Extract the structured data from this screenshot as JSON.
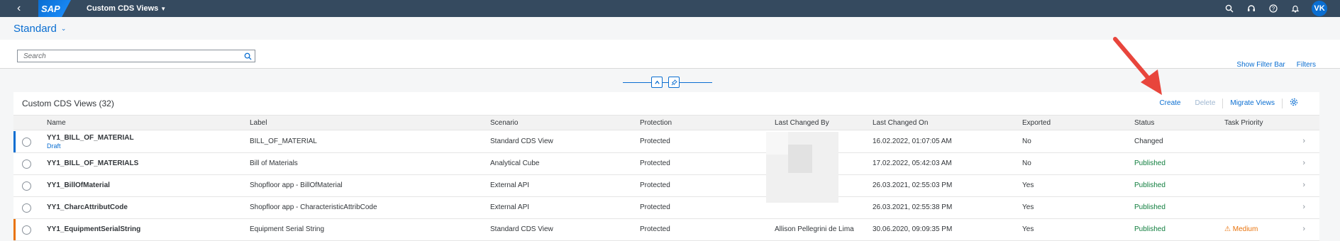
{
  "shell": {
    "logo": "SAP",
    "app_title": "Custom CDS Views",
    "avatar": "VK",
    "icons": [
      "chevron-left-icon",
      "search-icon",
      "headset-icon",
      "help-icon",
      "bell-icon"
    ]
  },
  "variant": {
    "title": "Standard"
  },
  "filter": {
    "search_placeholder": "Search",
    "show_filter_bar": "Show Filter Bar",
    "filters": "Filters"
  },
  "table": {
    "title": "Custom CDS Views (32)",
    "toolbar": {
      "create": "Create",
      "delete": "Delete",
      "migrate": "Migrate Views"
    },
    "columns": [
      "Name",
      "Label",
      "Scenario",
      "Protection",
      "Last Changed By",
      "Last Changed On",
      "Exported",
      "Status",
      "Task Priority"
    ],
    "rows": [
      {
        "name": "YY1_BILL_OF_MATERIAL",
        "draft": "Draft",
        "label": "BILL_OF_MATERIAL",
        "scenario": "Standard CDS View",
        "protection": "Protected",
        "changed_by": "",
        "changed_on": "16.02.2022, 01:07:05 AM",
        "exported": "No",
        "status": "Changed",
        "priority": "",
        "marker_color": "#0a6ed1"
      },
      {
        "name": "YY1_BILL_OF_MATERIALS",
        "draft": "",
        "label": "Bill of Materials",
        "scenario": "Analytical Cube",
        "protection": "Protected",
        "changed_by": "",
        "changed_on": "17.02.2022, 05:42:03 AM",
        "exported": "No",
        "status": "Published",
        "priority": "",
        "marker_color": ""
      },
      {
        "name": "YY1_BillOfMaterial",
        "draft": "",
        "label": "Shopfloor app - BillOfMaterial",
        "scenario": "External API",
        "protection": "Protected",
        "changed_by": "",
        "changed_on": "26.03.2021, 02:55:03 PM",
        "exported": "Yes",
        "status": "Published",
        "priority": "",
        "marker_color": ""
      },
      {
        "name": "YY1_CharcAttributCode",
        "draft": "",
        "label": "Shopfloor app - CharacteristicAttribCode",
        "scenario": "External API",
        "protection": "Protected",
        "changed_by": "",
        "changed_on": "26.03.2021, 02:55:38 PM",
        "exported": "Yes",
        "status": "Published",
        "priority": "",
        "marker_color": ""
      },
      {
        "name": "YY1_EquipmentSerialString",
        "draft": "",
        "label": "Equipment Serial String",
        "scenario": "Standard CDS View",
        "protection": "Protected",
        "changed_by": "Allison Pellegrini de Lima",
        "changed_on": "30.06.2020, 09:09:35 PM",
        "exported": "Yes",
        "status": "Published",
        "priority": "Medium",
        "marker_color": "#e9730c"
      }
    ]
  },
  "colors": {
    "shell": "#354a5f",
    "accent": "#0a6ed1",
    "published": "#107e3e",
    "arrow": "#e8453c"
  }
}
